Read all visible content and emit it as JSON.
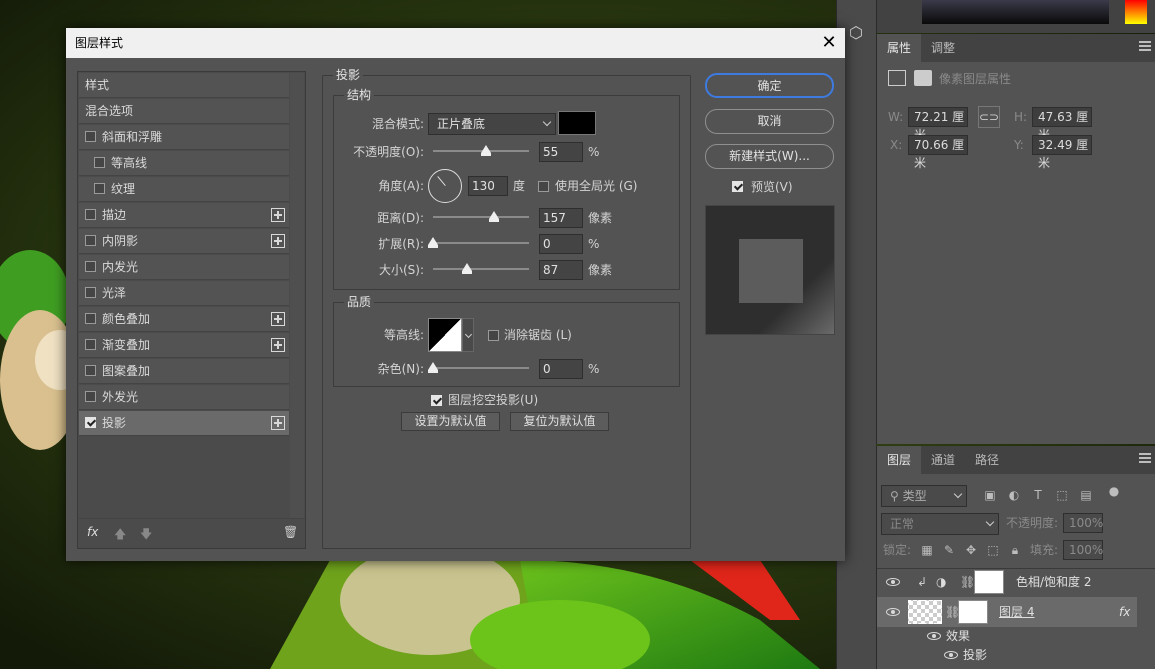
{
  "dialog": {
    "title": "图层样式",
    "style_list": {
      "header_styles": "样式",
      "header_blend": "混合选项",
      "items": [
        {
          "label": "斜面和浮雕",
          "checked": false,
          "plus": false,
          "indent": false
        },
        {
          "label": "等高线",
          "checked": false,
          "plus": false,
          "indent": true
        },
        {
          "label": "纹理",
          "checked": false,
          "plus": false,
          "indent": true
        },
        {
          "label": "描边",
          "checked": false,
          "plus": true,
          "indent": false
        },
        {
          "label": "内阴影",
          "checked": false,
          "plus": true,
          "indent": false
        },
        {
          "label": "内发光",
          "checked": false,
          "plus": false,
          "indent": false
        },
        {
          "label": "光泽",
          "checked": false,
          "plus": false,
          "indent": false
        },
        {
          "label": "颜色叠加",
          "checked": false,
          "plus": true,
          "indent": false
        },
        {
          "label": "渐变叠加",
          "checked": false,
          "plus": true,
          "indent": false
        },
        {
          "label": "图案叠加",
          "checked": false,
          "plus": false,
          "indent": false
        },
        {
          "label": "外发光",
          "checked": false,
          "plus": false,
          "indent": false
        },
        {
          "label": "投影",
          "checked": true,
          "plus": true,
          "indent": false,
          "selected": true
        }
      ],
      "fx_label": "fx"
    },
    "drop_shadow": {
      "title": "投影",
      "structure_title": "结构",
      "blend_mode_label": "混合模式:",
      "blend_mode_value": "正片叠底",
      "shadow_color": "#000000",
      "opacity_label": "不透明度(O):",
      "opacity_value": "55",
      "opacity_unit": "%",
      "opacity_fraction": 0.55,
      "angle_label": "角度(A):",
      "angle_value": "130",
      "angle_unit": "度",
      "global_light_label": "使用全局光 (G)",
      "distance_label": "距离(D):",
      "distance_value": "157",
      "distance_unit": "像素",
      "distance_fraction": 0.64,
      "spread_label": "扩展(R):",
      "spread_value": "0",
      "spread_unit": "%",
      "spread_fraction": 0,
      "size_label": "大小(S):",
      "size_value": "87",
      "size_unit": "像素",
      "size_fraction": 0.35,
      "quality_title": "品质",
      "contour_label": "等高线:",
      "anti_alias_label": "消除锯齿 (L)",
      "noise_label": "杂色(N):",
      "noise_value": "0",
      "noise_unit": "%",
      "noise_fraction": 0,
      "knockout_label": "图层挖空投影(U)",
      "make_default_label": "设置为默认值",
      "reset_default_label": "复位为默认值"
    },
    "buttons": {
      "ok": "确定",
      "cancel": "取消",
      "new_style": "新建样式(W)...",
      "preview_label": "预览(V)"
    }
  },
  "properties_panel": {
    "tab_properties": "属性",
    "tab_adjust": "调整",
    "pixel_layer_label": "像素图层属性",
    "w_label": "W:",
    "w_value": "72.21 厘米",
    "h_label": "H:",
    "h_value": "47.63 厘米",
    "x_label": "X:",
    "x_value": "70.66 厘米",
    "y_label": "Y:",
    "y_value": "32.49 厘米"
  },
  "layers_panel": {
    "tab_layers": "图层",
    "tab_channels": "通道",
    "tab_paths": "路径",
    "filter_kind": "类型",
    "blend_mode": "正常",
    "opacity_label": "不透明度:",
    "opacity_value": "100%",
    "lock_label": "锁定:",
    "fill_label": "填充:",
    "fill_value": "100%",
    "layers": [
      {
        "name": "色相/饱和度 2"
      },
      {
        "name": "图层 4"
      }
    ],
    "effects_label": "效果",
    "effect_drop_shadow": "投影",
    "fx_label": "fx"
  }
}
